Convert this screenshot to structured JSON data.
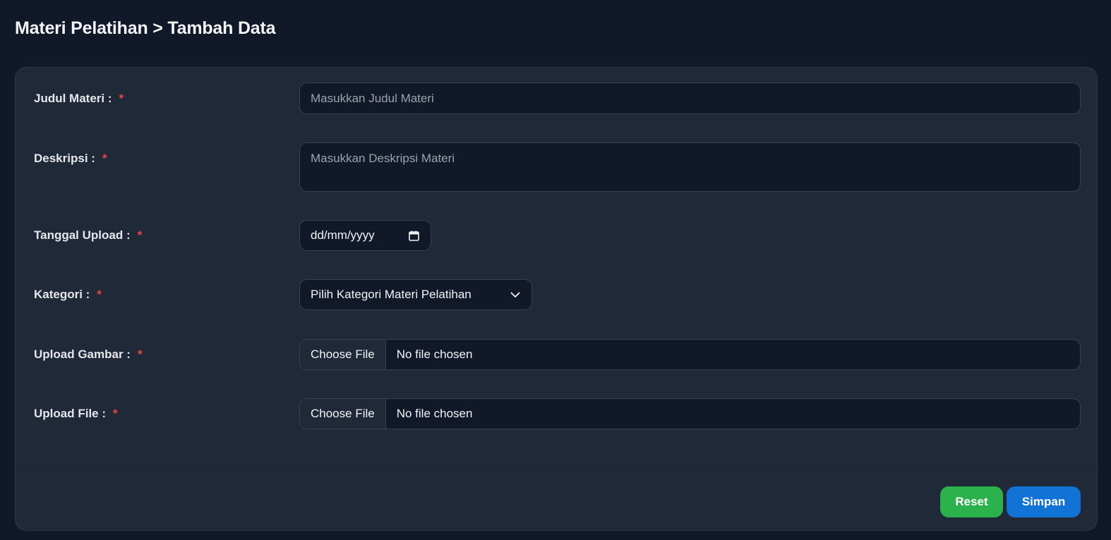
{
  "header": {
    "title": "Materi Pelatihan > Tambah Data"
  },
  "form": {
    "required_mark": "*",
    "judul": {
      "label": "Judul Materi :",
      "placeholder": "Masukkan Judul Materi"
    },
    "deskripsi": {
      "label": "Deskripsi :",
      "placeholder": "Masukkan Deskripsi Materi"
    },
    "tanggal": {
      "label": "Tanggal Upload :",
      "value": "dd/mm/yyyy",
      "icon": "calendar-icon"
    },
    "kategori": {
      "label": "Kategori :",
      "selected": "Pilih Kategori Materi Pelatihan",
      "icon": "chevron-down-icon"
    },
    "gambar": {
      "label": "Upload Gambar :",
      "button": "Choose File",
      "status": "No file chosen"
    },
    "file": {
      "label": "Upload File :",
      "button": "Choose File",
      "status": "No file chosen"
    }
  },
  "actions": {
    "reset": "Reset",
    "save": "Simpan"
  },
  "colors": {
    "background": "#111827",
    "card": "#1f2937",
    "required": "#ef4444",
    "reset_button": "#2bb24c",
    "save_button": "#1273d6"
  }
}
